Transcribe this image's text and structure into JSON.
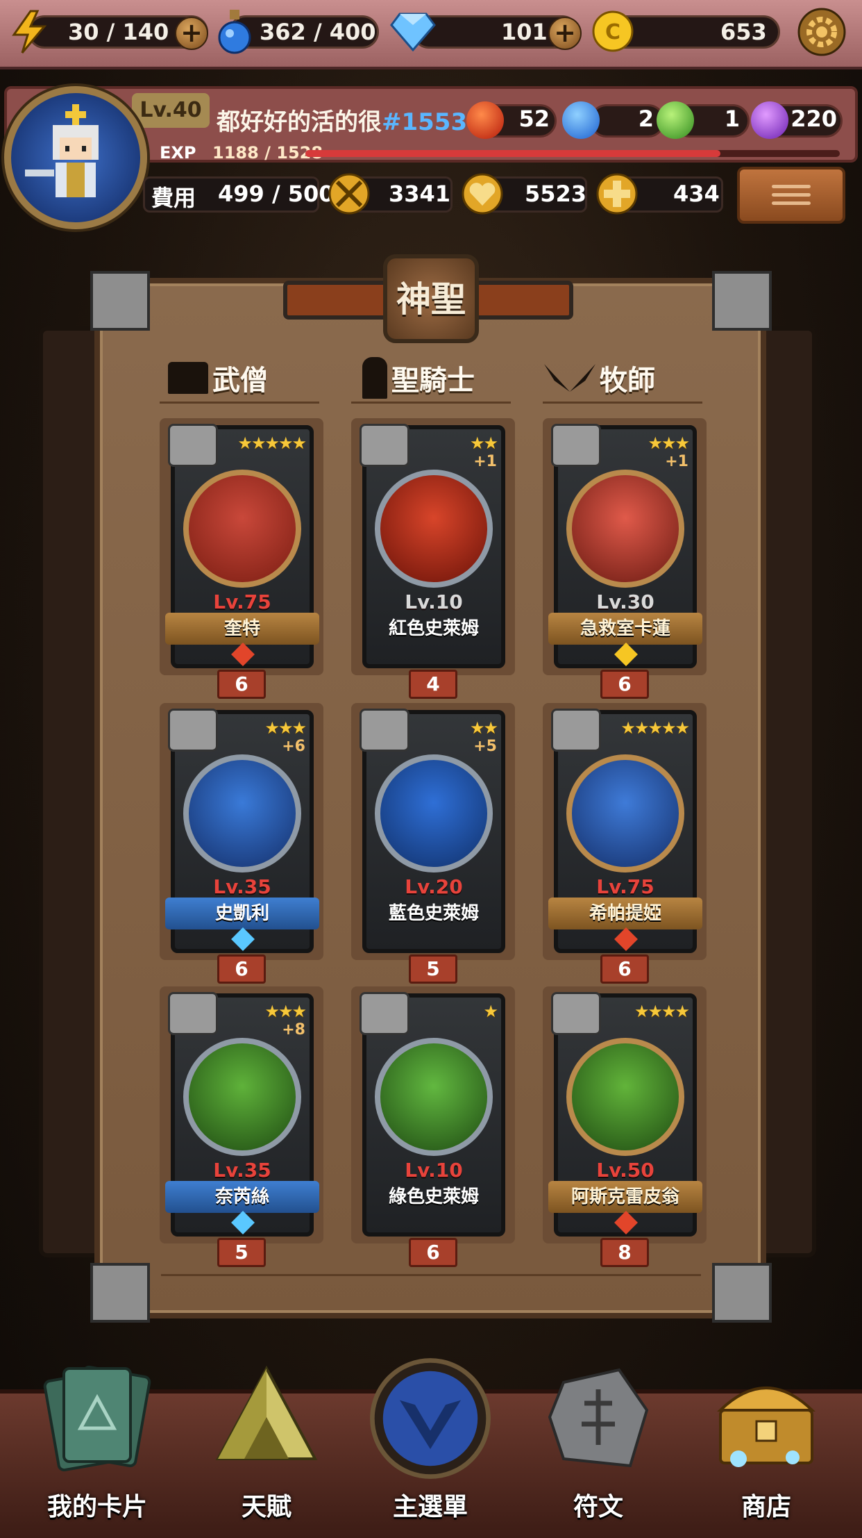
{
  "resources": {
    "energy": "30 / 140",
    "potion": "362 / 400",
    "diamond": "101",
    "gold": "653"
  },
  "player": {
    "level": "Lv.40",
    "name": "都好好的活的很",
    "tag": "#1553",
    "exp_label": "EXP",
    "exp": "1188 / 1528",
    "exp_fraction": 0.777,
    "orbs": {
      "red": "52",
      "blue": "2",
      "green": "1",
      "purple": "220"
    },
    "cost_label": "費用",
    "cost": "499 / 500",
    "attack": "3341",
    "hp": "5523",
    "heal": "434"
  },
  "board": {
    "title": "神聖",
    "columns": [
      "武僧",
      "聖騎士",
      "牧師"
    ]
  },
  "cards": [
    {
      "stars": "★★★★★",
      "plus": "",
      "level": "Lv.75",
      "name": "奎特",
      "cost": "6"
    },
    {
      "stars": "★★",
      "plus": "+1",
      "level": "Lv.10",
      "name": "紅色史萊姆",
      "cost": "4"
    },
    {
      "stars": "★★★",
      "plus": "+1",
      "level": "Lv.30",
      "name": "急救室卡蓮",
      "cost": "6"
    },
    {
      "stars": "★★★",
      "plus": "+6",
      "level": "Lv.35",
      "name": "史凱利",
      "cost": "6"
    },
    {
      "stars": "★★",
      "plus": "+5",
      "level": "Lv.20",
      "name": "藍色史萊姆",
      "cost": "5"
    },
    {
      "stars": "★★★★★",
      "plus": "",
      "level": "Lv.75",
      "name": "希帕提婭",
      "cost": "6"
    },
    {
      "stars": "★★★",
      "plus": "+8",
      "level": "Lv.35",
      "name": "奈芮絲",
      "cost": "5"
    },
    {
      "stars": "★",
      "plus": "",
      "level": "Lv.10",
      "name": "綠色史萊姆",
      "cost": "6"
    },
    {
      "stars": "★★★★",
      "plus": "",
      "level": "Lv.50",
      "name": "阿斯克雷皮翁",
      "cost": "8"
    }
  ],
  "nav": {
    "my_cards": "我的卡片",
    "talent": "天賦",
    "main_menu": "主選單",
    "runes": "符文",
    "shop": "商店"
  }
}
